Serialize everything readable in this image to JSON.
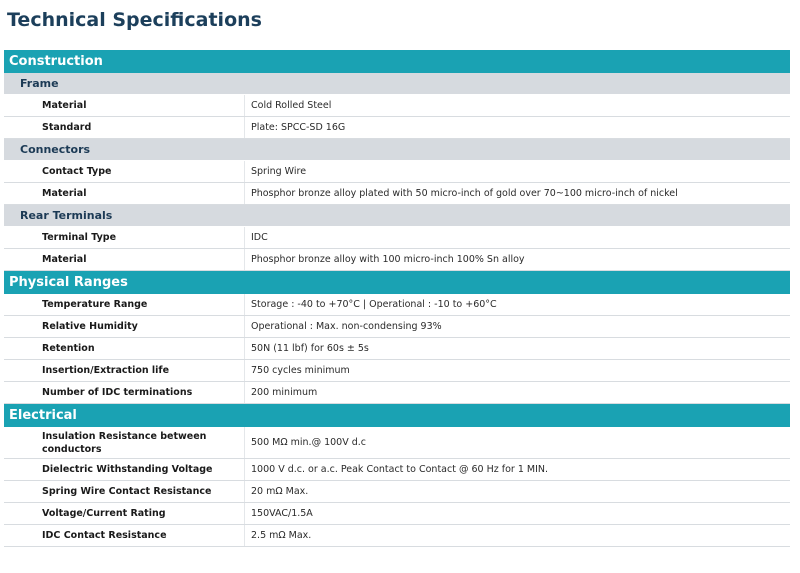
{
  "page": {
    "title": "Technical Specifications"
  },
  "sections": {
    "construction": {
      "title": "Construction",
      "frame": {
        "title": "Frame",
        "rows": [
          {
            "label": "Material",
            "value": "Cold Rolled Steel"
          },
          {
            "label": "Standard",
            "value": "Plate: SPCC-SD 16G"
          }
        ]
      },
      "connectors": {
        "title": "Connectors",
        "rows": [
          {
            "label": "Contact Type",
            "value": "Spring Wire"
          },
          {
            "label": "Material",
            "value": "Phosphor bronze alloy plated with 50 micro-inch of gold over 70~100 micro-inch of nickel"
          }
        ]
      },
      "rear_terminals": {
        "title": "Rear Terminals",
        "rows": [
          {
            "label": "Terminal Type",
            "value": "IDC"
          },
          {
            "label": "Material",
            "value": "Phosphor bronze alloy with 100 micro-inch 100% Sn alloy"
          }
        ]
      }
    },
    "physical_ranges": {
      "title": "Physical Ranges",
      "rows": [
        {
          "label": "Temperature Range",
          "value": "Storage : -40 to +70°C | Operational : -10 to +60°C"
        },
        {
          "label": "Relative Humidity",
          "value": "Operational : Max. non-condensing 93%"
        },
        {
          "label": "Retention",
          "value": "50N (11 lbf) for 60s ± 5s"
        },
        {
          "label": "Insertion/Extraction life",
          "value": "750 cycles minimum"
        },
        {
          "label": "Number of IDC terminations",
          "value": "200 minimum"
        }
      ]
    },
    "electrical": {
      "title": "Electrical",
      "rows": [
        {
          "label": "Insulation Resistance between conductors",
          "value": "500 MΩ min.@ 100V d.c"
        },
        {
          "label": "Dielectric Withstanding Voltage",
          "value": "1000 V d.c. or a.c. Peak Contact to Contact @ 60 Hz for 1 MIN."
        },
        {
          "label": "Spring Wire Contact Resistance",
          "value": "20 mΩ Max."
        },
        {
          "label": "Voltage/Current Rating",
          "value": "150VAC/1.5A"
        },
        {
          "label": "IDC Contact Resistance",
          "value": "2.5 mΩ Max."
        }
      ]
    }
  },
  "colors": {
    "section_header": "#1aa2b3",
    "group_header": "#d6dadf",
    "title": "#1c3f5b"
  }
}
